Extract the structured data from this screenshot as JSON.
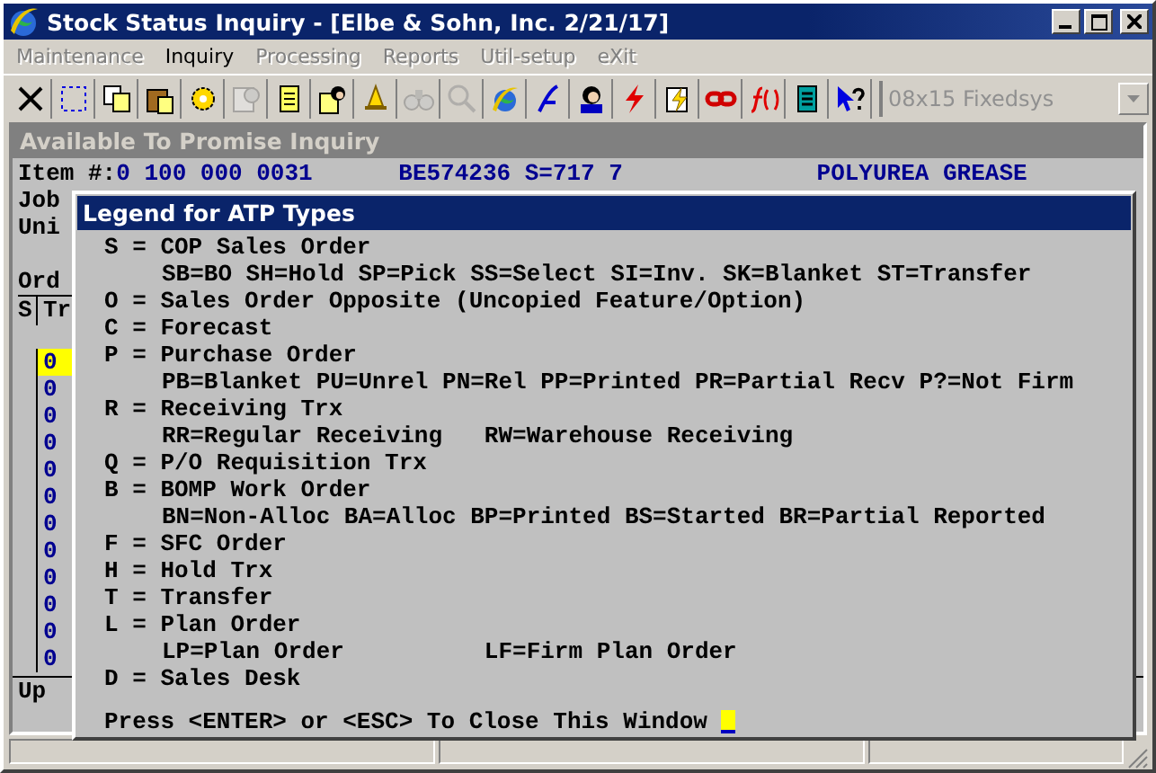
{
  "window": {
    "title": "Stock Status Inquiry - [Elbe & Sohn, Inc. 2/21/17]"
  },
  "menu": [
    {
      "label": "Maintenance",
      "disabled": true
    },
    {
      "label": "Inquiry",
      "disabled": false
    },
    {
      "label": "Processing",
      "disabled": true
    },
    {
      "label": "Reports",
      "disabled": true
    },
    {
      "label": "Util-setup",
      "disabled": true
    },
    {
      "label": "eXit",
      "disabled": true
    }
  ],
  "toolbar": {
    "buttons": [
      {
        "disabled": false
      },
      {
        "disabled": false
      },
      {
        "disabled": false
      },
      {
        "disabled": false
      },
      {
        "disabled": false
      },
      {
        "disabled": true
      },
      {
        "disabled": false
      },
      {
        "disabled": false
      },
      {
        "disabled": false
      },
      {
        "disabled": true
      },
      {
        "disabled": true
      },
      {
        "disabled": false
      },
      {
        "disabled": false
      },
      {
        "disabled": false
      },
      {
        "disabled": false
      },
      {
        "disabled": false
      },
      {
        "disabled": false
      },
      {
        "disabled": false
      },
      {
        "disabled": false
      },
      {
        "disabled": false
      }
    ],
    "font_select": {
      "value": "08x15 Fixedsys",
      "disabled": true
    }
  },
  "inquiry": {
    "title": "Available To Promise Inquiry",
    "item_label": "Item #:",
    "item_number": "0 100 000 0031",
    "item_code": "BE574236 S=717 7",
    "description": "POLYUREA GREASE",
    "labels": [
      "Job",
      "Uni"
    ],
    "order_label": "Ord",
    "columns": [
      "S",
      "Tr"
    ],
    "rows": [
      {
        "code": "0",
        "selected": true
      },
      {
        "code": "0",
        "selected": false
      },
      {
        "code": "0",
        "selected": false
      },
      {
        "code": "0",
        "selected": false
      },
      {
        "code": "0",
        "selected": false
      },
      {
        "code": "0",
        "selected": false
      },
      {
        "code": "0",
        "selected": false
      },
      {
        "code": "0",
        "selected": false
      },
      {
        "code": "0",
        "selected": false
      },
      {
        "code": "0",
        "selected": false
      },
      {
        "code": "0",
        "selected": false
      },
      {
        "code": "0",
        "selected": false
      }
    ],
    "footer": "Up"
  },
  "legend": {
    "title": "Legend for ATP Types",
    "lines": [
      {
        "kind": "type",
        "text": "S = COP Sales Order"
      },
      {
        "kind": "sub",
        "text": "SB=BO SH=Hold SP=Pick SS=Select SI=Inv. SK=Blanket ST=Transfer"
      },
      {
        "kind": "type",
        "text": "O = Sales Order Opposite (Uncopied Feature/Option)"
      },
      {
        "kind": "type",
        "text": "C = Forecast"
      },
      {
        "kind": "type",
        "text": "P = Purchase Order"
      },
      {
        "kind": "sub",
        "text": "PB=Blanket PU=Unrel PN=Rel PP=Printed PR=Partial Recv P?=Not Firm"
      },
      {
        "kind": "type",
        "text": "R = Receiving Trx"
      },
      {
        "kind": "sub",
        "text": "RR=Regular Receiving   RW=Warehouse Receiving"
      },
      {
        "kind": "type",
        "text": "Q = P/O Requisition Trx"
      },
      {
        "kind": "type",
        "text": "B = BOMP Work Order"
      },
      {
        "kind": "sub",
        "text": "BN=Non-Alloc BA=Alloc BP=Printed BS=Started BR=Partial Reported"
      },
      {
        "kind": "type",
        "text": "F = SFC Order"
      },
      {
        "kind": "type",
        "text": "H = Hold Trx"
      },
      {
        "kind": "type",
        "text": "T = Transfer"
      },
      {
        "kind": "type",
        "text": "L = Plan Order"
      },
      {
        "kind": "sub",
        "text": "LP=Plan Order          LF=Firm Plan Order"
      },
      {
        "kind": "type",
        "text": "D = Sales Desk"
      }
    ],
    "prompt": "Press <ENTER> or <ESC> To Close This Window"
  }
}
